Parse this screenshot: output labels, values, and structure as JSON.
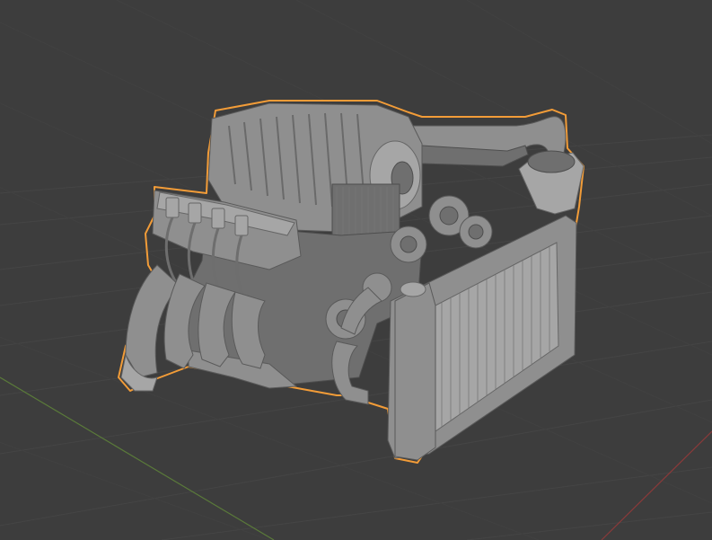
{
  "viewport": {
    "background_color": "#3d3d3d",
    "grid_color": "#454545",
    "x_axis_color": "#8a3a3a",
    "y_axis_color": "#5a7a3a",
    "selection_outline_color": "#f29c38",
    "object_color": "#8f8f8f"
  },
  "scene": {
    "object": "engine-model",
    "selected": true
  }
}
